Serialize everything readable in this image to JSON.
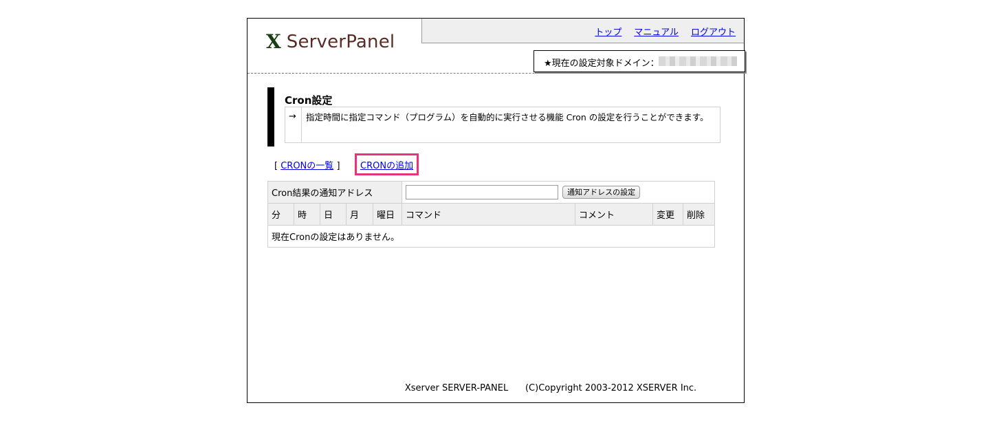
{
  "logo": {
    "mark": "X",
    "text": "ServerPanel"
  },
  "nav": {
    "top": "トップ",
    "manual": "マニュアル",
    "logout": "ログアウト"
  },
  "domain": {
    "label": "★現在の設定対象ドメイン："
  },
  "page": {
    "title": "Cron設定",
    "arrow": "→",
    "description": "指定時間に指定コマンド（プログラム）を自動的に実行させる機能 Cron の設定を行うことができます。"
  },
  "links": {
    "bracket_open": "[",
    "list": "CRONの一覧",
    "bracket_close": "]",
    "add": "CRONの追加"
  },
  "notify": {
    "label": "Cron結果の通知アドレス",
    "value": "",
    "button": "通知アドレスの設定"
  },
  "table": {
    "headers": [
      "分",
      "時",
      "日",
      "月",
      "曜日",
      "コマンド",
      "コメント",
      "変更",
      "削除"
    ],
    "empty_message": "現在Cronの設定はありません。"
  },
  "footer": {
    "text": "Xserver SERVER-PANEL      (C)Copyright 2003-2012 XSERVER Inc."
  }
}
